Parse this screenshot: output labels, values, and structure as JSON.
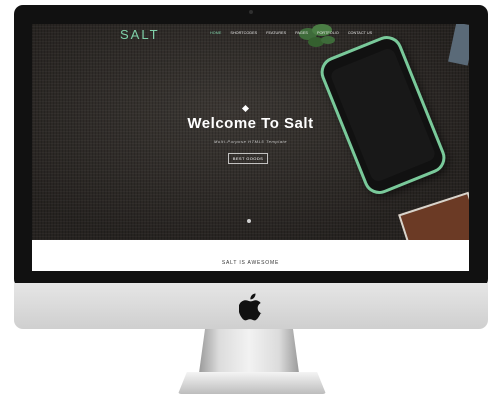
{
  "site": {
    "logo": "SALT",
    "nav": [
      {
        "label": "HOME",
        "active": true
      },
      {
        "label": "SHORTCODES",
        "active": false
      },
      {
        "label": "FEATURES",
        "active": false
      },
      {
        "label": "PAGES",
        "active": false
      },
      {
        "label": "PORTFOLIO",
        "active": false
      },
      {
        "label": "CONTACT US",
        "active": false
      }
    ],
    "hero": {
      "title": "Welcome To Salt",
      "subtitle": "Multi-Purpose HTML5 Template",
      "button": "BEST GOODS"
    },
    "tagline": "SALT IS AWESOME"
  },
  "colors": {
    "accent": "#7fd0a8",
    "monitor_bezel": "#111111",
    "chin": "#dcdcdc"
  }
}
